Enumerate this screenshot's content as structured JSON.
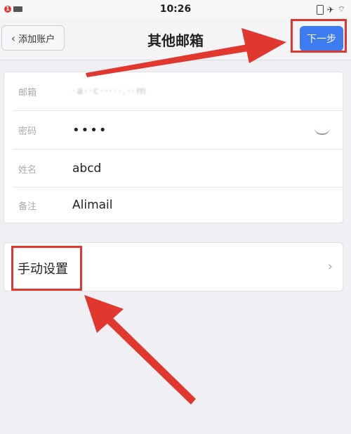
{
  "status_bar": {
    "notification_count": "1",
    "time": "10:26"
  },
  "nav": {
    "back_label": "添加账户",
    "title": "其他邮箱",
    "next_label": "下一步"
  },
  "form": {
    "rows": [
      {
        "label": "邮箱",
        "value": "·a··c·····.··m"
      },
      {
        "label": "密码",
        "value": "••••"
      },
      {
        "label": "姓名",
        "value": "abcd"
      },
      {
        "label": "备注",
        "value": "Alimail"
      }
    ]
  },
  "manual": {
    "label": "手动设置"
  },
  "annotation_color": "#e0382f",
  "accent_color": "#3d7cf0"
}
